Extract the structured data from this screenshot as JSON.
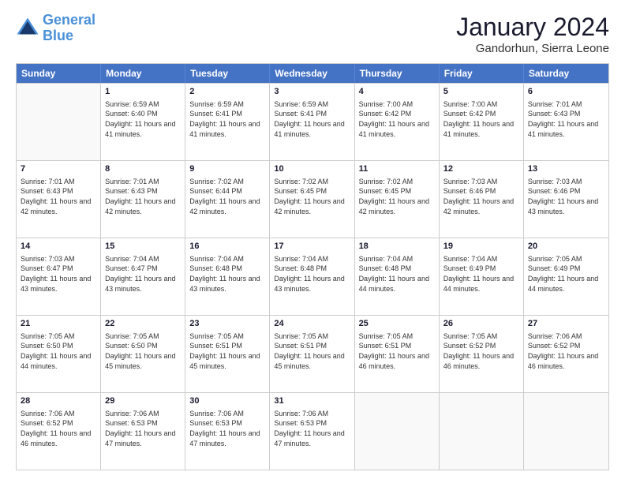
{
  "logo": {
    "line1": "General",
    "line2": "Blue"
  },
  "title": "January 2024",
  "location": "Gandorhun, Sierra Leone",
  "days": [
    "Sunday",
    "Monday",
    "Tuesday",
    "Wednesday",
    "Thursday",
    "Friday",
    "Saturday"
  ],
  "weeks": [
    [
      {
        "day": "",
        "sunrise": "",
        "sunset": "",
        "daylight": ""
      },
      {
        "day": "1",
        "sunrise": "Sunrise: 6:59 AM",
        "sunset": "Sunset: 6:40 PM",
        "daylight": "Daylight: 11 hours and 41 minutes."
      },
      {
        "day": "2",
        "sunrise": "Sunrise: 6:59 AM",
        "sunset": "Sunset: 6:41 PM",
        "daylight": "Daylight: 11 hours and 41 minutes."
      },
      {
        "day": "3",
        "sunrise": "Sunrise: 6:59 AM",
        "sunset": "Sunset: 6:41 PM",
        "daylight": "Daylight: 11 hours and 41 minutes."
      },
      {
        "day": "4",
        "sunrise": "Sunrise: 7:00 AM",
        "sunset": "Sunset: 6:42 PM",
        "daylight": "Daylight: 11 hours and 41 minutes."
      },
      {
        "day": "5",
        "sunrise": "Sunrise: 7:00 AM",
        "sunset": "Sunset: 6:42 PM",
        "daylight": "Daylight: 11 hours and 41 minutes."
      },
      {
        "day": "6",
        "sunrise": "Sunrise: 7:01 AM",
        "sunset": "Sunset: 6:43 PM",
        "daylight": "Daylight: 11 hours and 41 minutes."
      }
    ],
    [
      {
        "day": "7",
        "sunrise": "Sunrise: 7:01 AM",
        "sunset": "Sunset: 6:43 PM",
        "daylight": "Daylight: 11 hours and 42 minutes."
      },
      {
        "day": "8",
        "sunrise": "Sunrise: 7:01 AM",
        "sunset": "Sunset: 6:43 PM",
        "daylight": "Daylight: 11 hours and 42 minutes."
      },
      {
        "day": "9",
        "sunrise": "Sunrise: 7:02 AM",
        "sunset": "Sunset: 6:44 PM",
        "daylight": "Daylight: 11 hours and 42 minutes."
      },
      {
        "day": "10",
        "sunrise": "Sunrise: 7:02 AM",
        "sunset": "Sunset: 6:45 PM",
        "daylight": "Daylight: 11 hours and 42 minutes."
      },
      {
        "day": "11",
        "sunrise": "Sunrise: 7:02 AM",
        "sunset": "Sunset: 6:45 PM",
        "daylight": "Daylight: 11 hours and 42 minutes."
      },
      {
        "day": "12",
        "sunrise": "Sunrise: 7:03 AM",
        "sunset": "Sunset: 6:46 PM",
        "daylight": "Daylight: 11 hours and 42 minutes."
      },
      {
        "day": "13",
        "sunrise": "Sunrise: 7:03 AM",
        "sunset": "Sunset: 6:46 PM",
        "daylight": "Daylight: 11 hours and 43 minutes."
      }
    ],
    [
      {
        "day": "14",
        "sunrise": "Sunrise: 7:03 AM",
        "sunset": "Sunset: 6:47 PM",
        "daylight": "Daylight: 11 hours and 43 minutes."
      },
      {
        "day": "15",
        "sunrise": "Sunrise: 7:04 AM",
        "sunset": "Sunset: 6:47 PM",
        "daylight": "Daylight: 11 hours and 43 minutes."
      },
      {
        "day": "16",
        "sunrise": "Sunrise: 7:04 AM",
        "sunset": "Sunset: 6:48 PM",
        "daylight": "Daylight: 11 hours and 43 minutes."
      },
      {
        "day": "17",
        "sunrise": "Sunrise: 7:04 AM",
        "sunset": "Sunset: 6:48 PM",
        "daylight": "Daylight: 11 hours and 43 minutes."
      },
      {
        "day": "18",
        "sunrise": "Sunrise: 7:04 AM",
        "sunset": "Sunset: 6:48 PM",
        "daylight": "Daylight: 11 hours and 44 minutes."
      },
      {
        "day": "19",
        "sunrise": "Sunrise: 7:04 AM",
        "sunset": "Sunset: 6:49 PM",
        "daylight": "Daylight: 11 hours and 44 minutes."
      },
      {
        "day": "20",
        "sunrise": "Sunrise: 7:05 AM",
        "sunset": "Sunset: 6:49 PM",
        "daylight": "Daylight: 11 hours and 44 minutes."
      }
    ],
    [
      {
        "day": "21",
        "sunrise": "Sunrise: 7:05 AM",
        "sunset": "Sunset: 6:50 PM",
        "daylight": "Daylight: 11 hours and 44 minutes."
      },
      {
        "day": "22",
        "sunrise": "Sunrise: 7:05 AM",
        "sunset": "Sunset: 6:50 PM",
        "daylight": "Daylight: 11 hours and 45 minutes."
      },
      {
        "day": "23",
        "sunrise": "Sunrise: 7:05 AM",
        "sunset": "Sunset: 6:51 PM",
        "daylight": "Daylight: 11 hours and 45 minutes."
      },
      {
        "day": "24",
        "sunrise": "Sunrise: 7:05 AM",
        "sunset": "Sunset: 6:51 PM",
        "daylight": "Daylight: 11 hours and 45 minutes."
      },
      {
        "day": "25",
        "sunrise": "Sunrise: 7:05 AM",
        "sunset": "Sunset: 6:51 PM",
        "daylight": "Daylight: 11 hours and 46 minutes."
      },
      {
        "day": "26",
        "sunrise": "Sunrise: 7:05 AM",
        "sunset": "Sunset: 6:52 PM",
        "daylight": "Daylight: 11 hours and 46 minutes."
      },
      {
        "day": "27",
        "sunrise": "Sunrise: 7:06 AM",
        "sunset": "Sunset: 6:52 PM",
        "daylight": "Daylight: 11 hours and 46 minutes."
      }
    ],
    [
      {
        "day": "28",
        "sunrise": "Sunrise: 7:06 AM",
        "sunset": "Sunset: 6:52 PM",
        "daylight": "Daylight: 11 hours and 46 minutes."
      },
      {
        "day": "29",
        "sunrise": "Sunrise: 7:06 AM",
        "sunset": "Sunset: 6:53 PM",
        "daylight": "Daylight: 11 hours and 47 minutes."
      },
      {
        "day": "30",
        "sunrise": "Sunrise: 7:06 AM",
        "sunset": "Sunset: 6:53 PM",
        "daylight": "Daylight: 11 hours and 47 minutes."
      },
      {
        "day": "31",
        "sunrise": "Sunrise: 7:06 AM",
        "sunset": "Sunset: 6:53 PM",
        "daylight": "Daylight: 11 hours and 47 minutes."
      },
      {
        "day": "",
        "sunrise": "",
        "sunset": "",
        "daylight": ""
      },
      {
        "day": "",
        "sunrise": "",
        "sunset": "",
        "daylight": ""
      },
      {
        "day": "",
        "sunrise": "",
        "sunset": "",
        "daylight": ""
      }
    ]
  ]
}
